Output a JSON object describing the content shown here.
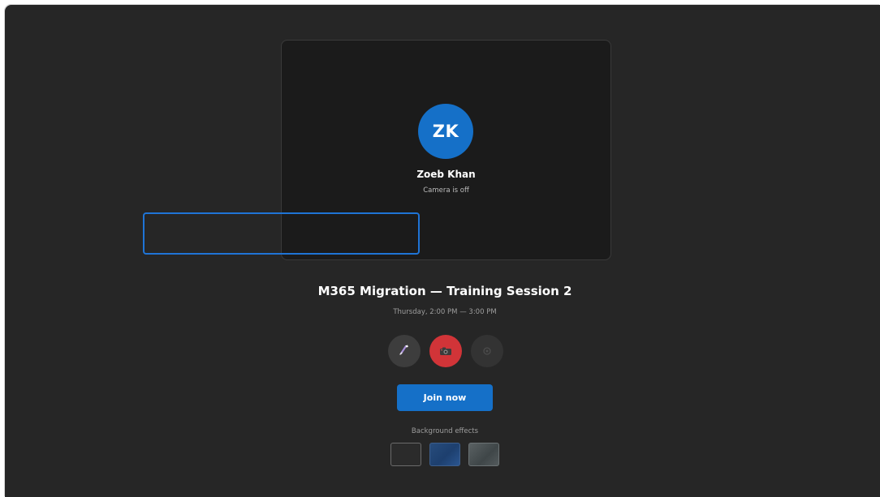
{
  "preview": {
    "avatar_initials": "ZK",
    "user_name": "Zoeb Khan",
    "camera_status": "Camera is off"
  },
  "meeting": {
    "title": "M365 Migration — Training Session 2",
    "time": "Thursday, 2:00 PM — 3:00 PM"
  },
  "controls": {
    "mic": {
      "icon": "microphone-icon",
      "state": "on"
    },
    "camera": {
      "icon": "camera-off-icon",
      "state": "off",
      "color": "#d13438"
    },
    "settings": {
      "icon": "gear-icon"
    }
  },
  "join": {
    "label": "Join now",
    "color": "#1570c8"
  },
  "background_effects": {
    "label": "Background effects",
    "options": [
      "none",
      "blue",
      "slate"
    ]
  }
}
